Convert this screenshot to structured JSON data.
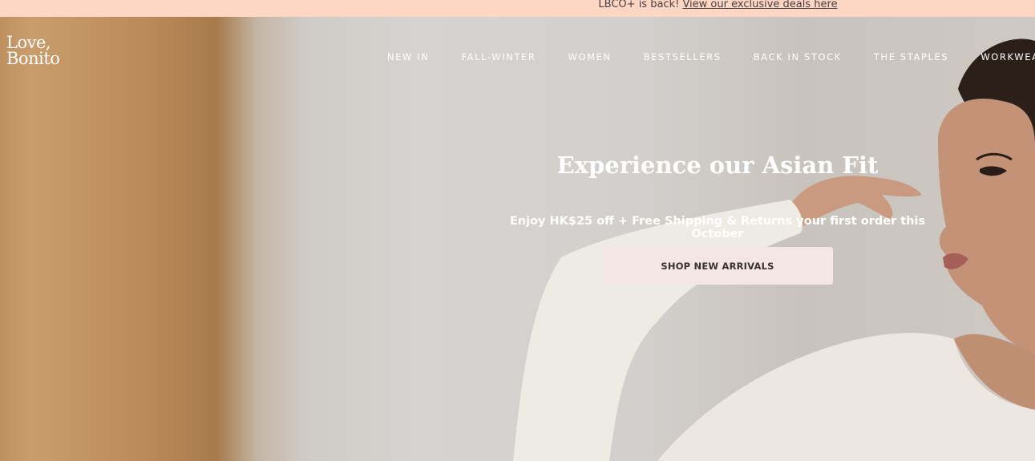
{
  "announcement": {
    "text": "LBCO+ is back!",
    "link": "View our exclusive deals here"
  },
  "brand": {
    "logo_line1": "Love,",
    "logo_line2": "Bonito"
  },
  "nav": {
    "items": [
      "NEW IN",
      "FALL-WINTER",
      "WOMEN",
      "BESTSELLERS",
      "BACK IN STOCK",
      "THE STAPLES",
      "WORKWEAR"
    ]
  },
  "hero": {
    "headline": "Experience our Asian Fit",
    "subline": "Enjoy HK$25 off + Free Shipping & Returns your first order this October",
    "cta_label": "SHOP NEW ARRIVALS"
  },
  "colors": {
    "announcement_bg": "#fdd6c4",
    "cta_bg": "#f4e6e3"
  }
}
